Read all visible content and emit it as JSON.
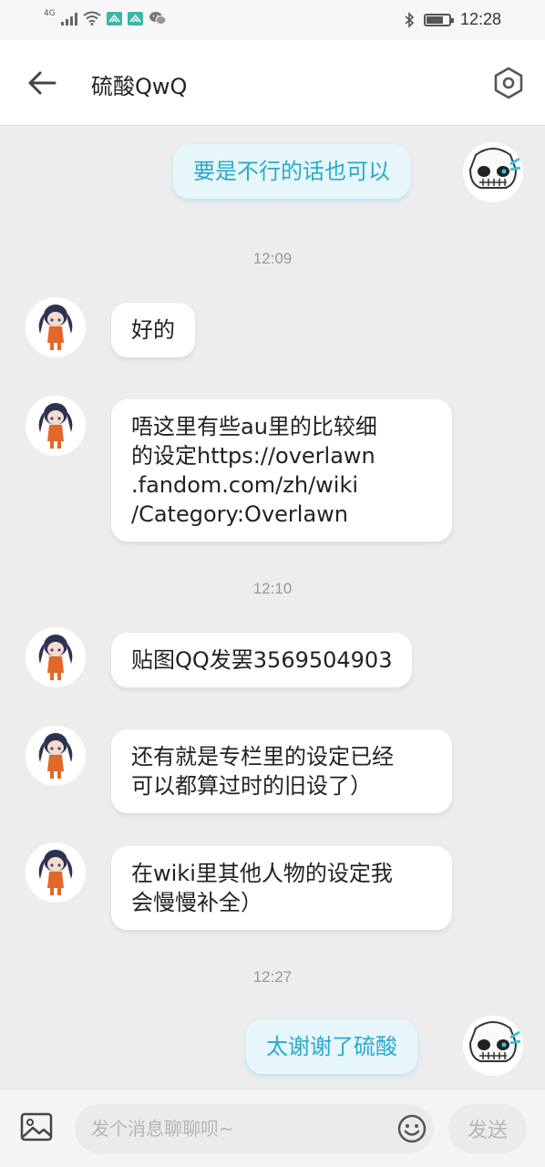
{
  "status_bar": {
    "network": "4G",
    "time": "12:28",
    "icons": [
      "signal-icon",
      "wifi-icon",
      "app-notification-icon",
      "app-notification-icon",
      "wechat-icon",
      "bluetooth-icon",
      "battery-icon"
    ]
  },
  "header": {
    "title": "硫酸QwQ",
    "back_icon": "arrow-left-icon",
    "settings_icon": "settings-hexagon-icon"
  },
  "messages": [
    {
      "type": "sent",
      "text": "要是不行的话也可以"
    },
    {
      "type": "time",
      "text": "12:09"
    },
    {
      "type": "received",
      "text": "好的"
    },
    {
      "type": "received",
      "lines": [
        "唔这里有些au里的比较细",
        "的设定https://overlawn",
        ".fandom.com/zh/wiki",
        "/Category:Overlawn"
      ]
    },
    {
      "type": "time",
      "text": "12:10"
    },
    {
      "type": "received",
      "text": "贴图QQ发罢3569504903"
    },
    {
      "type": "received",
      "lines": [
        "还有就是专栏里的设定已经",
        "可以都算过时的旧设了）"
      ]
    },
    {
      "type": "received",
      "lines": [
        "在wiki里其他人物的设定我",
        "会慢慢补全）"
      ]
    },
    {
      "type": "time",
      "text": "12:27"
    },
    {
      "type": "sent",
      "text": "太谢谢了硫酸"
    }
  ],
  "input_bar": {
    "placeholder": "发个消息聊聊呗~",
    "value": "",
    "send_label": "发送",
    "image_icon": "image-icon",
    "emoji_icon": "emoji-icon"
  },
  "colors": {
    "background": "#ededed",
    "sent_bubble": "#e6f6fb",
    "sent_text": "#2aa9cc",
    "received_bubble": "#ffffff"
  }
}
